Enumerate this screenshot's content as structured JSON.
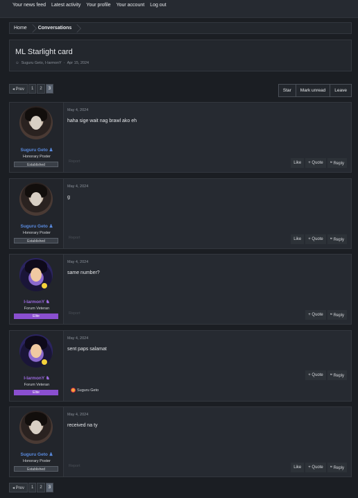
{
  "topnav": {
    "items": [
      "Your news feed",
      "Latest activity",
      "Your profile",
      "Your account",
      "Log out"
    ]
  },
  "breadcrumb": [
    "Home",
    "Conversations"
  ],
  "title": {
    "text": "ML Starlight card",
    "participants": "Suguru Geto, I-larmonY",
    "date": "Apr 15, 2024"
  },
  "pager": {
    "prev_label": "◂ Prev",
    "pages": [
      "1",
      "2",
      "3"
    ],
    "active_page": "3"
  },
  "actions": [
    "Star",
    "Mark unread",
    "Leave"
  ],
  "labels": {
    "report": "Report",
    "like": "Like",
    "quote": "+ Quote",
    "reply": "❝ Reply"
  },
  "messages": [
    {
      "user": "Suguru Geto",
      "user_icon": "user-plus-icon",
      "user_title": "Honorary Poster",
      "banner": "Established",
      "date": "May 4, 2024",
      "body": "haha sige wait nag brawl ako eh",
      "show_like": true
    },
    {
      "user": "Suguru Geto",
      "user_icon": "user-plus-icon",
      "user_title": "Honorary Poster",
      "banner": "Established",
      "date": "May 4, 2024",
      "body": "g",
      "show_like": true
    },
    {
      "user": "I-larmonY",
      "user_icon": "user-group-icon",
      "user_title": "Forum Veteran",
      "banner": "Elite",
      "date": "May 4, 2024",
      "body": "same number?",
      "show_like": false
    },
    {
      "user": "I-larmonY",
      "user_icon": "user-group-icon",
      "user_title": "Forum Veteran",
      "banner": "Elite",
      "date": "May 4, 2024",
      "body": "sent paps salamat",
      "show_like": false,
      "reaction_by": "Suguru Geto"
    },
    {
      "user": "Suguru Geto",
      "user_icon": "user-plus-icon",
      "user_title": "Honorary Poster",
      "banner": "Established",
      "date": "May 4, 2024",
      "body": "received na ty",
      "show_like": true
    }
  ]
}
